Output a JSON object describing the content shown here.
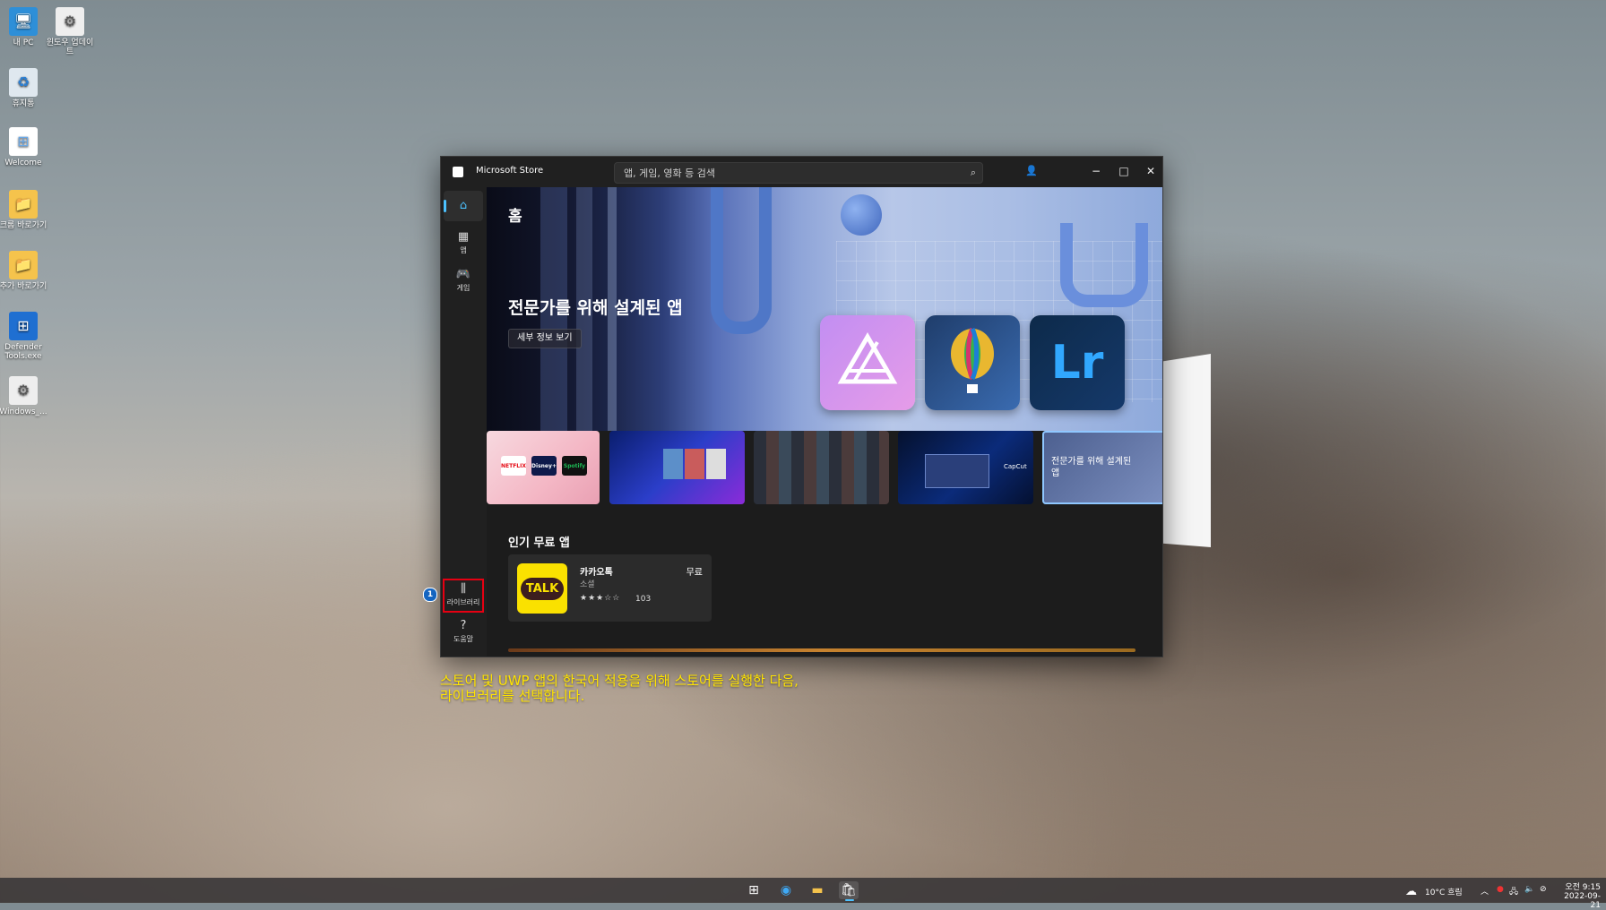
{
  "desktop": {
    "icons": [
      {
        "label": "내 PC",
        "glyph": "🖥"
      },
      {
        "label": "윈도우 업데이트",
        "glyph": "⚙"
      },
      {
        "label": "휴지통",
        "glyph": "♻"
      },
      {
        "label": "Welcome",
        "glyph": "⊞"
      },
      {
        "label": "크롬 바로가기",
        "glyph": "📁"
      },
      {
        "label": "추가 바로가기",
        "glyph": "📁"
      },
      {
        "label": "Defender Tools.exe",
        "glyph": "⊞"
      },
      {
        "label": "Windows_...",
        "glyph": "⚙"
      }
    ]
  },
  "window": {
    "title": "Microsoft Store",
    "search_placeholder": "앱, 게임, 영화 등 검색",
    "controls": {
      "minimize": "−",
      "maximize": "□",
      "close": "✕"
    }
  },
  "nav": {
    "home": {
      "icon": "⌂"
    },
    "apps": {
      "label": "앱",
      "icon": "▦"
    },
    "games": {
      "label": "게임",
      "icon": "🎮"
    },
    "library": {
      "label": "라이브러리",
      "icon": "⫼"
    },
    "help": {
      "label": "도움말",
      "icon": "?"
    }
  },
  "step_badge": "1",
  "hero": {
    "page_title": "홈",
    "heading": "전문가를 위해 설계된 앱",
    "button": "세부 정보 보기",
    "tiles": {
      "lr": "Lr"
    }
  },
  "carousel": {
    "card1_logos": {
      "netflix": "NETFLIX",
      "disney": "Disney+",
      "spotify": "Spotify"
    },
    "card4_logo": "CapCut",
    "card5_text": "전문가를 위해 설계된 앱"
  },
  "popular": {
    "title": "인기 무료 앱",
    "app": {
      "name": "카카오톡",
      "category": "소셜",
      "price": "무료",
      "rating": 3,
      "stars": "★★★☆☆",
      "review_count": "103",
      "icon_text": "TALK"
    }
  },
  "caption": {
    "line1": "스토어 및 UWP 앱의 한국어 적용을 위해 스토어를 실행한 다음,",
    "line2": "라이브러리를 선택합니다."
  },
  "taskbar": {
    "weather": "10°C  흐림",
    "time": "오전 9:15",
    "date": "2022-09-21"
  },
  "colors": {
    "accent": "#4cc2ff",
    "highlight_box": "#e60012",
    "caption": "#ffe400",
    "kakao_yellow": "#fae100"
  }
}
